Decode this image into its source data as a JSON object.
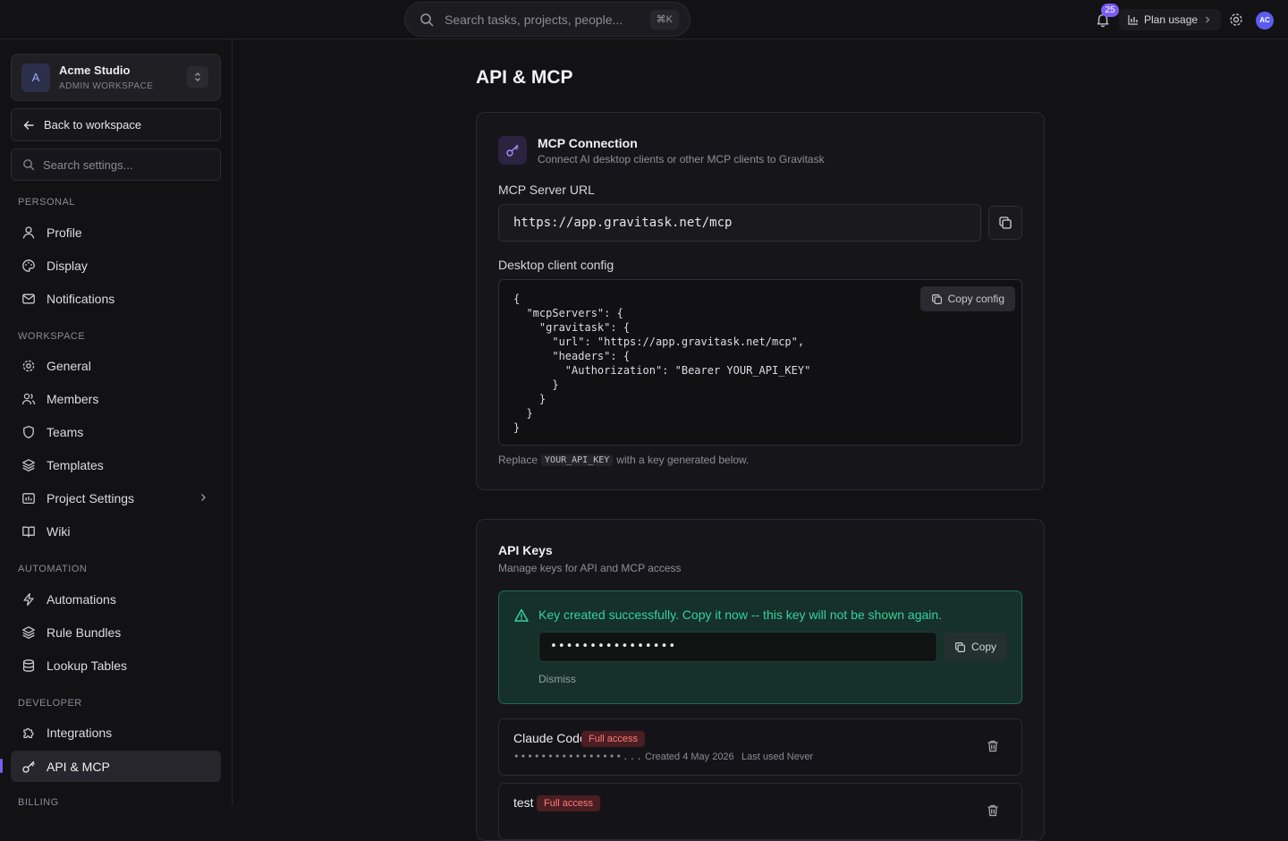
{
  "topbar": {
    "search_placeholder": "Search tasks, projects, people...",
    "search_shortcut": "⌘K",
    "notification_count": "25",
    "plan_usage_label": "Plan usage",
    "avatar_initials": "AC"
  },
  "workspace": {
    "logo_letter": "A",
    "name": "Acme Studio",
    "subtitle": "ADMIN WORKSPACE"
  },
  "sidebar": {
    "back_label": "Back to workspace",
    "search_placeholder": "Search settings...",
    "sections": {
      "personal": "PERSONAL",
      "workspace": "WORKSPACE",
      "automation": "AUTOMATION",
      "developer": "DEVELOPER",
      "billing": "BILLING"
    },
    "items": {
      "profile": "Profile",
      "display": "Display",
      "notifications": "Notifications",
      "general": "General",
      "members": "Members",
      "teams": "Teams",
      "templates": "Templates",
      "project_settings": "Project Settings",
      "wiki": "Wiki",
      "automations": "Automations",
      "rule_bundles": "Rule Bundles",
      "lookup_tables": "Lookup Tables",
      "integrations": "Integrations",
      "api_mcp": "API & MCP"
    }
  },
  "page": {
    "title": "API & MCP"
  },
  "mcp": {
    "title": "MCP Connection",
    "subtitle": "Connect AI desktop clients or other MCP clients to Gravitask",
    "url_label": "MCP Server URL",
    "url_value": "https://app.gravitask.net/mcp",
    "config_label": "Desktop client config",
    "config_code": "{\n  \"mcpServers\": {\n    \"gravitask\": {\n      \"url\": \"https://app.gravitask.net/mcp\",\n      \"headers\": {\n        \"Authorization\": \"Bearer YOUR_API_KEY\"\n      }\n    }\n  }\n}",
    "copy_config_label": "Copy config",
    "note_prefix": "Replace",
    "note_code": "YOUR_API_KEY",
    "note_suffix": "with a key generated below."
  },
  "api_keys": {
    "title": "API Keys",
    "subtitle": "Manage keys for API and MCP access",
    "success_message": "Key created successfully. Copy it now -- this key will not be shown again.",
    "new_key_masked": "••••••••••••••••",
    "copy_label": "Copy",
    "dismiss_label": "Dismiss",
    "keys": [
      {
        "name": "Claude Code",
        "access": "Full access",
        "masked": "••••••••••••••••...",
        "created": "Created 4 May 2026",
        "last_used": "Last used Never"
      },
      {
        "name": "test",
        "access": "Full access"
      }
    ]
  },
  "colors": {
    "accent": "#7c5cf5",
    "success": "#34d399",
    "danger": "#ff7a7a"
  }
}
